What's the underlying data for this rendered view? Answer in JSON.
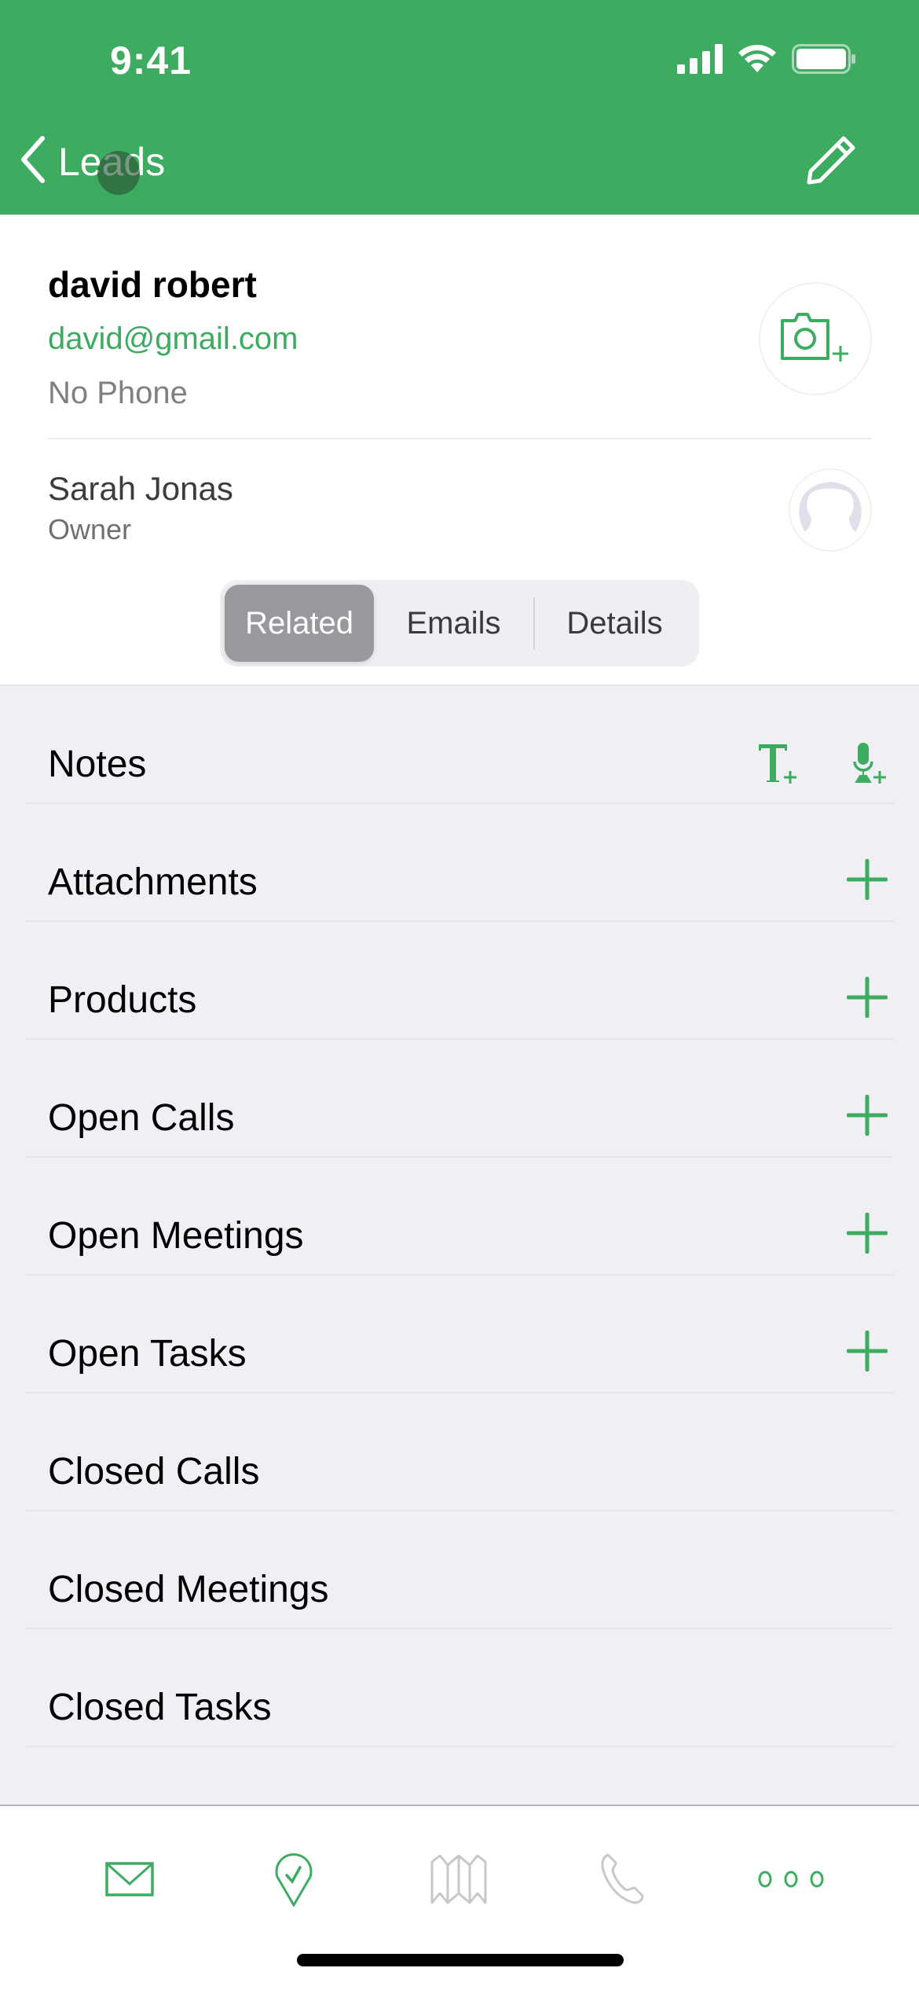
{
  "colors": {
    "brand_green": "#3dab60",
    "header_bg": "#3dab60",
    "list_bg": "#f0eff4",
    "inactive_icon": "#c8c8cc"
  },
  "status_bar": {
    "time": "9:41",
    "icons": [
      "cellular-signal-icon",
      "wifi-icon",
      "battery-icon"
    ]
  },
  "nav": {
    "back_label": "Leads",
    "back_icon": "chevron-left-icon",
    "edit_icon": "pencil-icon"
  },
  "lead": {
    "name": "david robert",
    "email": "david@gmail.com",
    "phone": "No Phone",
    "photo_button_icon": "camera-add-icon"
  },
  "owner": {
    "name": "Sarah Jonas",
    "role": "Owner",
    "avatar_icon": "user-avatar-placeholder-icon"
  },
  "segments": {
    "selected": "Related",
    "items": [
      {
        "label": "Related",
        "active": true
      },
      {
        "label": "Emails",
        "active": false
      },
      {
        "label": "Details",
        "active": false
      }
    ]
  },
  "related_sections": [
    {
      "label": "Notes",
      "actions": [
        "add-text-note-icon",
        "add-voice-note-icon"
      ]
    },
    {
      "label": "Attachments",
      "actions": [
        "plus-icon"
      ]
    },
    {
      "label": "Products",
      "actions": [
        "plus-icon"
      ]
    },
    {
      "label": "Open Calls",
      "actions": [
        "plus-icon"
      ]
    },
    {
      "label": "Open Meetings",
      "actions": [
        "plus-icon"
      ]
    },
    {
      "label": "Open Tasks",
      "actions": [
        "plus-icon"
      ]
    },
    {
      "label": "Closed Calls",
      "actions": []
    },
    {
      "label": "Closed Meetings",
      "actions": []
    },
    {
      "label": "Closed Tasks",
      "actions": []
    }
  ],
  "tabbar": {
    "items": [
      {
        "icon": "mail-icon",
        "enabled": true
      },
      {
        "icon": "location-check-icon",
        "enabled": true
      },
      {
        "icon": "map-icon",
        "enabled": false
      },
      {
        "icon": "phone-icon",
        "enabled": false
      },
      {
        "icon": "more-icon",
        "enabled": true
      }
    ]
  }
}
